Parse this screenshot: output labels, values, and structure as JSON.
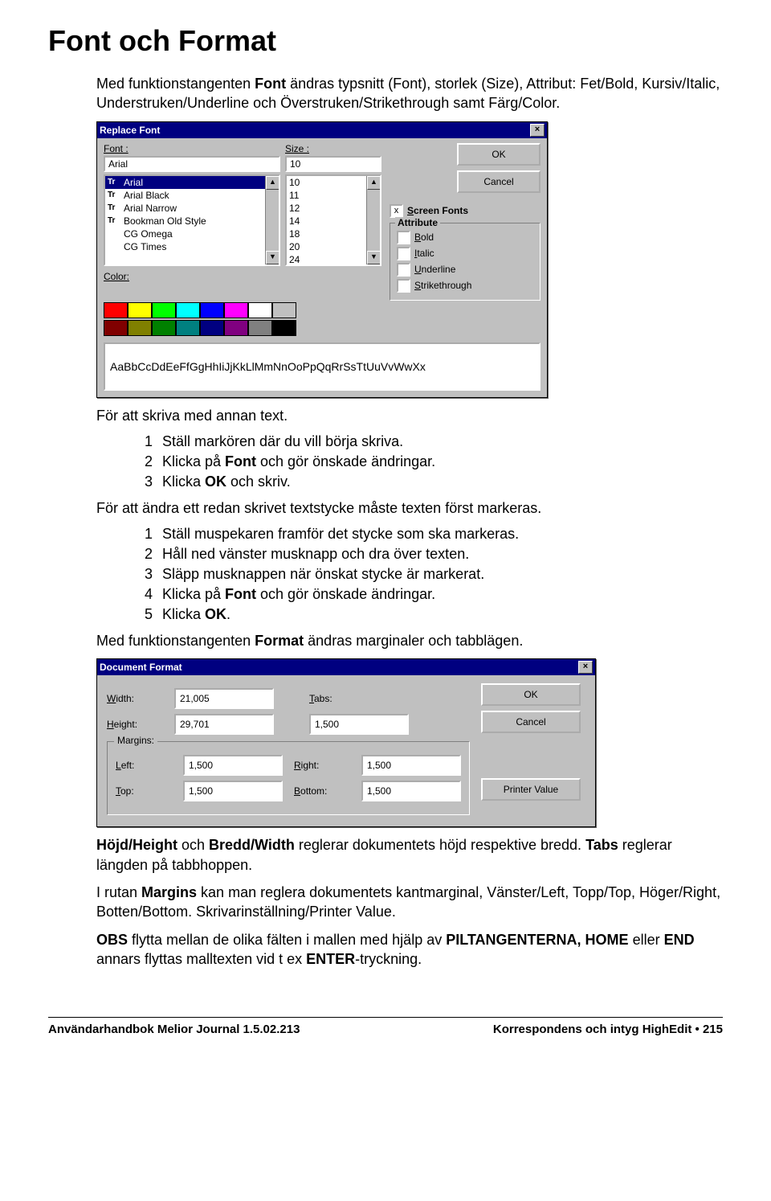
{
  "heading": "Font och Format",
  "intro_parts": [
    "Med funktionstangenten ",
    "Font",
    " ändras typsnitt (Font), storlek (Size), Attribut: Fet/Bold, Kursiv/Italic, Understruken/Underline och Överstruken/Strikethrough samt Färg/Color."
  ],
  "replace_font": {
    "title": "Replace Font",
    "font_label": "Font :",
    "size_label": "Size :",
    "font_value": "Arial",
    "size_value": "10",
    "font_list": [
      "Arial",
      "Arial Black",
      "Arial Narrow",
      "Bookman Old Style",
      "CG Omega",
      "CG Times"
    ],
    "size_list": [
      "10",
      "11",
      "12",
      "14",
      "18",
      "20",
      "24"
    ],
    "ok": "OK",
    "cancel": "Cancel",
    "screen_fonts": "Screen Fonts",
    "attribute": "Attribute",
    "bold": "Bold",
    "italic": "Italic",
    "underline": "Underline",
    "strikethrough": "Strikethrough",
    "color_label": "Color:",
    "palette_row1": [
      "#ff0000",
      "#ffff00",
      "#00ff00",
      "#00ffff",
      "#0000ff",
      "#ff00ff",
      "#ffffff",
      "#c0c0c0"
    ],
    "palette_row2": [
      "#800000",
      "#808000",
      "#008000",
      "#008080",
      "#000080",
      "#800080",
      "#808080",
      "#000000"
    ],
    "preview": "AaBbCcDdEeFfGgHhIiJjKkLlMmNnOoPpQqRrSsTtUuVvWwXx"
  },
  "para_write": "För att skriva med annan text.",
  "list1": [
    {
      "n": "1",
      "parts": [
        "Ställ markören där du vill börja skriva."
      ]
    },
    {
      "n": "2",
      "parts": [
        "Klicka på ",
        "Font",
        " och gör önskade ändringar."
      ]
    },
    {
      "n": "3",
      "parts": [
        "Klicka ",
        "OK",
        " och skriv."
      ]
    }
  ],
  "para_mark": "För att ändra ett redan skrivet textstycke måste texten först markeras.",
  "list2": [
    {
      "n": "1",
      "parts": [
        "Ställ muspekaren framför det stycke som ska markeras."
      ]
    },
    {
      "n": "2",
      "parts": [
        "Håll ned vänster musknapp och dra över texten."
      ]
    },
    {
      "n": "3",
      "parts": [
        "Släpp musknappen när önskat stycke är markerat."
      ]
    },
    {
      "n": "4",
      "parts": [
        "Klicka på ",
        "Font",
        " och gör önskade ändringar."
      ]
    },
    {
      "n": "5",
      "parts": [
        "Klicka ",
        "OK",
        "."
      ]
    }
  ],
  "para_format": [
    "Med funktionstangenten ",
    "Format",
    " ändras marginaler och tabblägen."
  ],
  "doc_format": {
    "title": "Document Format",
    "width_l": "Width:",
    "width_v": "21,005",
    "height_l": "Height:",
    "height_v": "29,701",
    "tabs_l": "Tabs:",
    "tabs_v": "1,500",
    "margins": "Margins:",
    "left_l": "Left:",
    "left_v": "1,500",
    "right_l": "Right:",
    "right_v": "1,500",
    "top_l": "Top:",
    "top_v": "1,500",
    "bottom_l": "Bottom:",
    "bottom_v": "1,500",
    "ok": "OK",
    "cancel": "Cancel",
    "printer": "Printer Value"
  },
  "end_paras": [
    [
      "",
      "Höjd/Height",
      " och ",
      "Bredd/Width",
      " reglerar dokumentets höjd respektive bredd. ",
      "Tabs",
      " reglerar längden på tabbhoppen."
    ],
    [
      "I rutan ",
      "Margins",
      " kan man reglera dokumentets kantmarginal, Vänster/Left, Topp/Top, Höger/Right, Botten/Bottom. Skrivarinställning/Printer Value."
    ],
    [
      "",
      "OBS",
      " flytta mellan de olika fälten i mallen med hjälp av ",
      "PILTANGENTERNA, HOME",
      " eller ",
      "END",
      " annars flyttas malltexten vid t ex ",
      "ENTER",
      "-tryckning."
    ]
  ],
  "footer_left": "Användarhandbok Melior Journal 1.5.02.213",
  "footer_right": "Korrespondens och intyg HighEdit • 215"
}
